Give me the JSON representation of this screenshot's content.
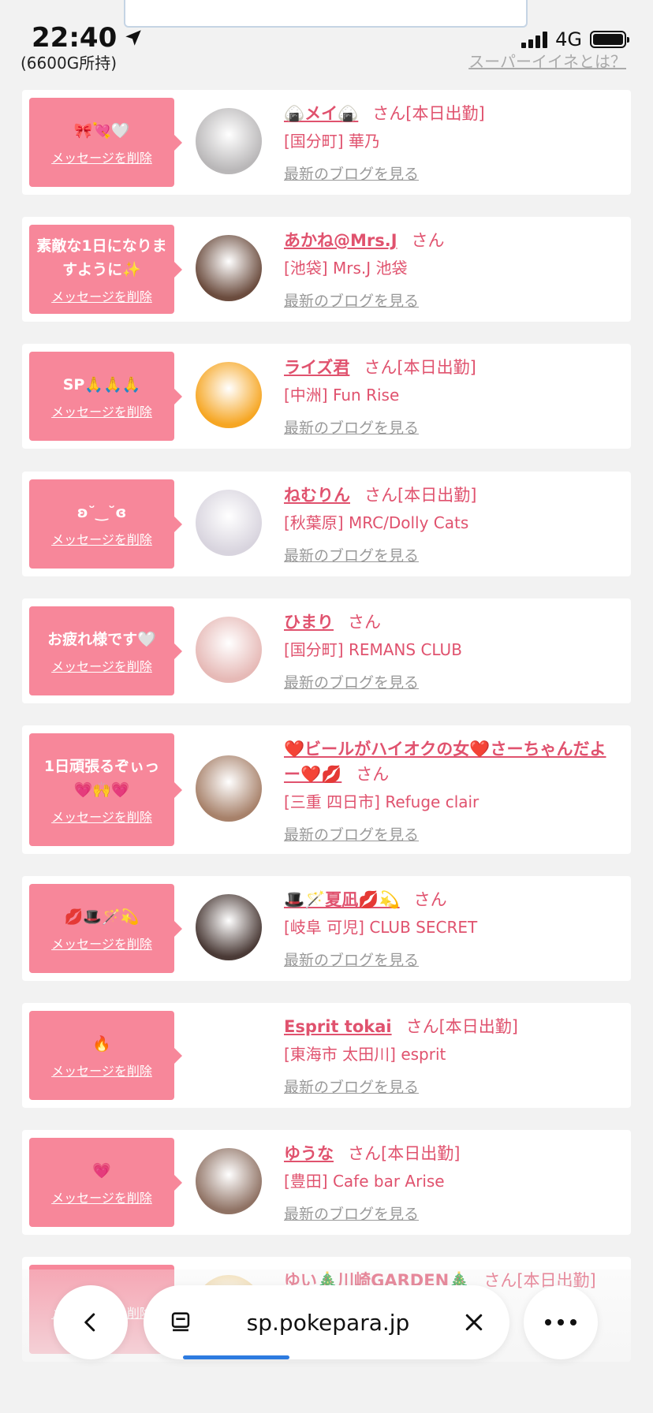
{
  "status": {
    "time": "22:40",
    "network": "4G",
    "points": "(6600G所持)",
    "super_link": "スーパーイイネとは？"
  },
  "cards": [
    {
      "msg": "🎀💘🤍",
      "delete": "メッセージを削除",
      "name": "🍙メイ🍙",
      "san": "さん",
      "today": "[本日出勤]",
      "shop": "[国分町] 華乃",
      "blog": "最新のブログを見る",
      "avatar_color": "#b9b7b8"
    },
    {
      "msg": "素敵な1日になりますように✨",
      "delete": "メッセージを削除",
      "name": "あかね@Mrs.J",
      "san": "さん",
      "today": "",
      "shop": "[池袋] Mrs.J 池袋",
      "blog": "最新のブログを見る",
      "avatar_color": "#6b4c3e"
    },
    {
      "msg": "SP🙏🙏🙏",
      "delete": "メッセージを削除",
      "name": "ライズ君",
      "san": "さん",
      "today": "[本日出勤]",
      "shop": "[中洲] Fun Rise",
      "blog": "最新のブログを見る",
      "avatar_color": "#f6a623"
    },
    {
      "msg": "ʚ˘‿˘ɞ",
      "delete": "メッセージを削除",
      "name": "ねむりん",
      "san": "さん",
      "today": "[本日出勤]",
      "shop": "[秋葉原] MRC/Dolly Cats",
      "blog": "最新のブログを見る",
      "avatar_color": "#d8d4de"
    },
    {
      "msg": "お疲れ様です🤍",
      "delete": "メッセージを削除",
      "name": "ひまり",
      "san": "さん",
      "today": "",
      "shop": "[国分町] REMANS CLUB",
      "blog": "最新のブログを見る",
      "avatar_color": "#e6b9b6"
    },
    {
      "msg": "1日頑張るぞぃっ💗🙌💗",
      "delete": "メッセージを削除",
      "name": "❤️ビールがハイオクの女❤️さーちゃんだよー❤️💋",
      "san": "さん",
      "today": "",
      "shop": "[三重 四日市] Refuge clair",
      "blog": "最新のブログを見る",
      "avatar_color": "#a7816a"
    },
    {
      "msg": "💋🎩🪄💫",
      "delete": "メッセージを削除",
      "name": "🎩🪄夏凪💋💫",
      "san": "さん",
      "today": "",
      "shop": "[岐阜 可児] CLUB SECRET",
      "blog": "最新のブログを見る",
      "avatar_color": "#4a3a36"
    },
    {
      "msg": "🔥",
      "delete": "メッセージを削除",
      "name": "Esprit tokai",
      "san": "さん",
      "today": "[本日出勤]",
      "shop": "[東海市 太田川] esprit",
      "blog": "最新のブログを見る",
      "avatar_color": "#ffffff"
    },
    {
      "msg": "💗",
      "delete": "メッセージを削除",
      "name": "ゆうな",
      "san": "さん",
      "today": "[本日出勤]",
      "shop": "[豊田] Cafe bar Arise",
      "blog": "最新のブログを見る",
      "avatar_color": "#8f7264"
    },
    {
      "msg": "",
      "delete": "メッセージを削除",
      "name": "ゆい🎄川崎GARDEN🎄",
      "san": "さん",
      "today": "[本日出勤]",
      "shop": "",
      "blog": "",
      "avatar_color": "#f0d090"
    }
  ],
  "browser": {
    "url": "sp.pokepara.jp",
    "load_progress": 0.29
  }
}
